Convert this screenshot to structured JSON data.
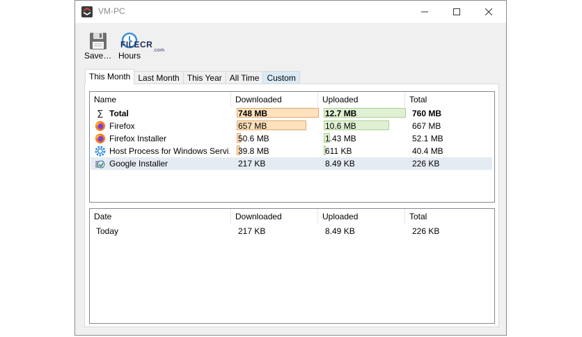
{
  "window": {
    "title": "VM-PC"
  },
  "toolbar": {
    "save_label": "Save…",
    "hours_label": "Hours",
    "watermark": "FILECR",
    "watermark_suffix": ".com"
  },
  "tabs": [
    "This Month",
    "Last Month",
    "This Year",
    "All Time",
    "Custom"
  ],
  "apps_table": {
    "columns": [
      "Name",
      "Downloaded",
      "Uploaded",
      "Total"
    ],
    "rows": [
      {
        "icon": "sigma-icon",
        "name": "Total",
        "downloaded": "748 MB",
        "uploaded": "12.7 MB",
        "total": "760 MB",
        "dl_fraction": 1.0,
        "ul_fraction": 1.0
      },
      {
        "icon": "firefox-icon",
        "name": "Firefox",
        "downloaded": "657 MB",
        "uploaded": "10.6 MB",
        "total": "667 MB",
        "dl_fraction": 0.85,
        "ul_fraction": 0.8
      },
      {
        "icon": "firefox-icon",
        "name": "Firefox Installer",
        "downloaded": "50.6 MB",
        "uploaded": "1.43 MB",
        "total": "52.1 MB",
        "dl_fraction": 0.05,
        "ul_fraction": 0.08
      },
      {
        "icon": "gear-icon",
        "name": "Host Process for Windows Servi...",
        "downloaded": "39.8 MB",
        "uploaded": "611 KB",
        "total": "40.4 MB",
        "dl_fraction": 0.04,
        "ul_fraction": 0.02
      },
      {
        "icon": "installer-icon",
        "name": "Google Installer",
        "downloaded": "217 KB",
        "uploaded": "8.49 KB",
        "total": "226 KB",
        "dl_fraction": 0,
        "ul_fraction": 0
      }
    ]
  },
  "dates_table": {
    "columns": [
      "Date",
      "Downloaded",
      "Uploaded",
      "Total"
    ],
    "rows": [
      {
        "date": "Today",
        "downloaded": "217 KB",
        "uploaded": "8.49 KB",
        "total": "226 KB"
      }
    ]
  },
  "colors": {
    "download_bar": "#fde2bd",
    "upload_bar": "#e0f0d3",
    "selected_row": "#e5ebf3"
  }
}
